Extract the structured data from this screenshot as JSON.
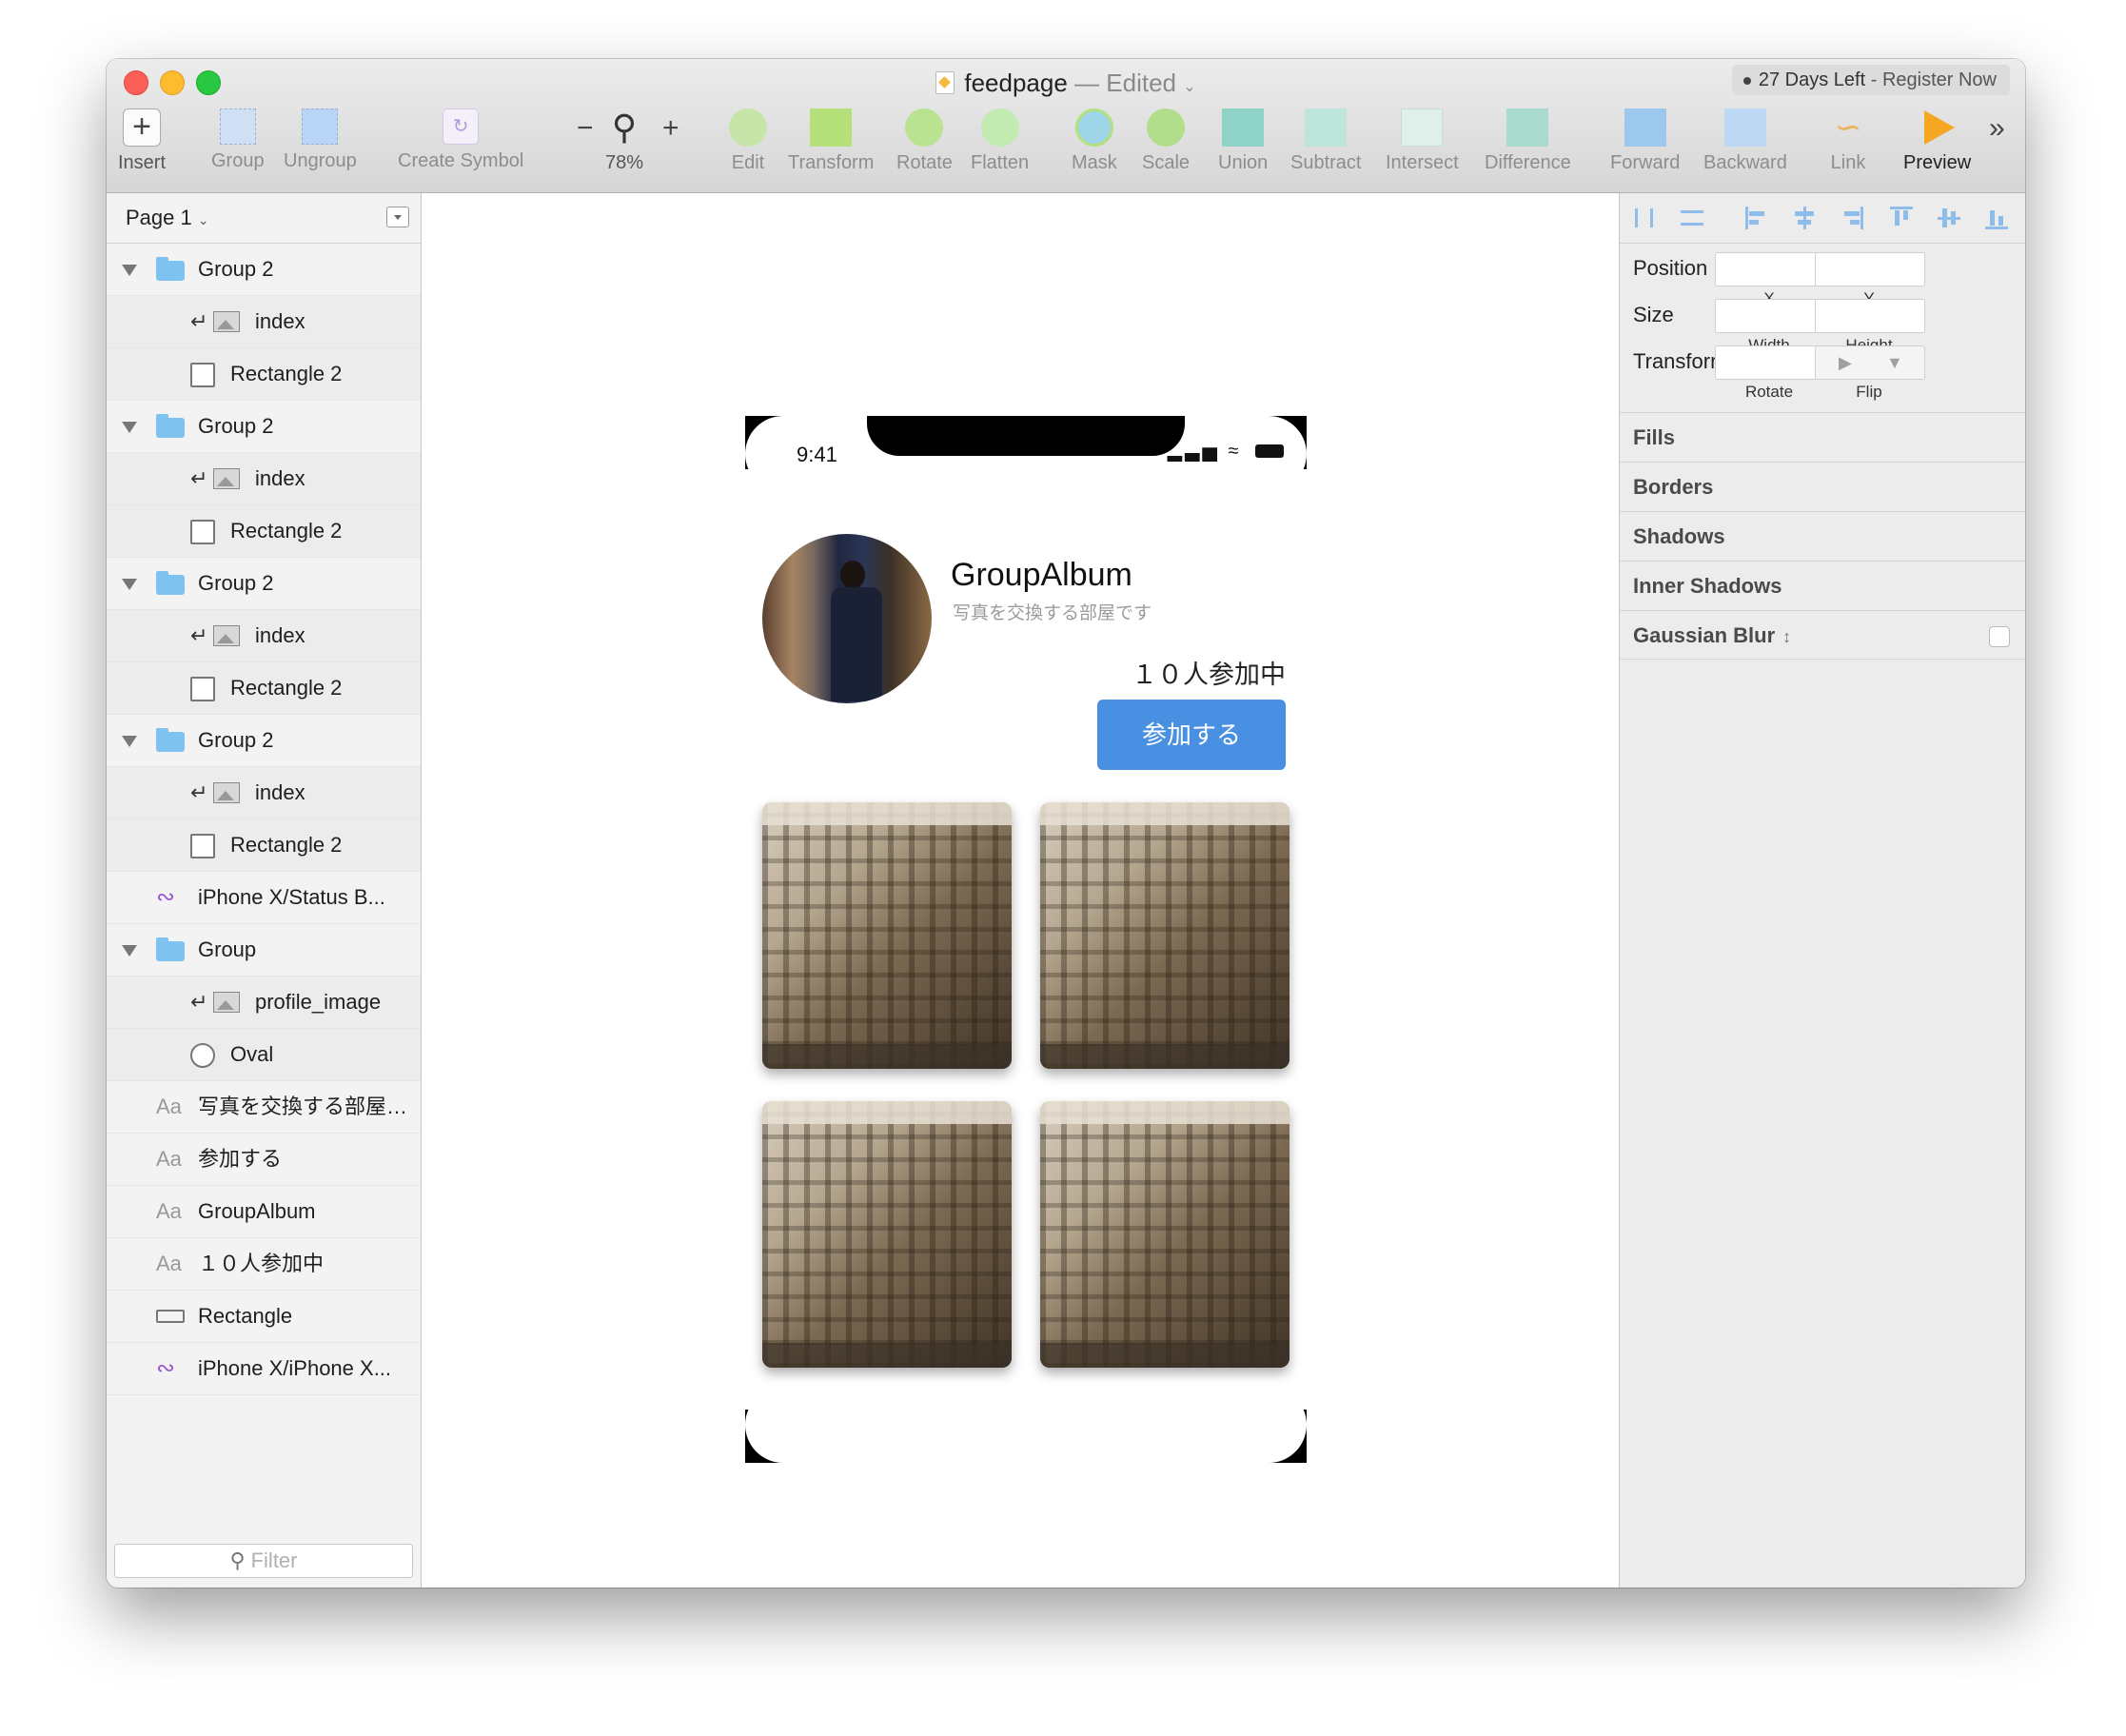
{
  "window": {
    "doc_name": "feedpage",
    "doc_status": "— Edited",
    "trial_days": "27 Days Left",
    "trial_sep": " - ",
    "trial_register": "Register Now"
  },
  "toolbar": {
    "insert": "Insert",
    "group": "Group",
    "ungroup": "Ungroup",
    "create_symbol": "Create Symbol",
    "zoom_minus": "−",
    "zoom_plus": "+",
    "zoom": "78%",
    "edit": "Edit",
    "transform": "Transform",
    "rotate": "Rotate",
    "flatten": "Flatten",
    "mask": "Mask",
    "scale": "Scale",
    "union": "Union",
    "subtract": "Subtract",
    "intersect": "Intersect",
    "difference": "Difference",
    "forward": "Forward",
    "backward": "Backward",
    "link": "Link",
    "preview": "Preview",
    "more": "»"
  },
  "sidebar": {
    "page": "Page 1",
    "filter_placeholder": "Filter",
    "layers": [
      {
        "name": "Group 2"
      },
      {
        "name": "index"
      },
      {
        "name": "Rectangle 2"
      },
      {
        "name": "Group 2"
      },
      {
        "name": "index"
      },
      {
        "name": "Rectangle 2"
      },
      {
        "name": "Group 2"
      },
      {
        "name": "index"
      },
      {
        "name": "Rectangle 2"
      },
      {
        "name": "Group 2"
      },
      {
        "name": "index"
      },
      {
        "name": "Rectangle 2"
      },
      {
        "name": "iPhone X/Status B..."
      },
      {
        "name": "Group"
      },
      {
        "name": "profile_image"
      },
      {
        "name": "Oval"
      },
      {
        "name": "写真を交換する部屋…"
      },
      {
        "name": "参加する"
      },
      {
        "name": "GroupAlbum"
      },
      {
        "name": "１０人参加中"
      },
      {
        "name": "Rectangle"
      },
      {
        "name": "iPhone X/iPhone X..."
      }
    ],
    "text_icon": "Aa"
  },
  "artboard": {
    "time": "9:41",
    "title": "GroupAlbum",
    "subtitle": "写真を交換する部屋です",
    "members": "１０人参加中",
    "join_button": "参加する"
  },
  "inspector": {
    "position": "Position",
    "x": "X",
    "y": "Y",
    "size": "Size",
    "width": "Width",
    "height": "Height",
    "transform": "Transform",
    "rotate": "Rotate",
    "flip": "Flip",
    "fills": "Fills",
    "borders": "Borders",
    "shadows": "Shadows",
    "inner_shadows": "Inner Shadows",
    "gaussian_blur": "Gaussian Blur"
  }
}
